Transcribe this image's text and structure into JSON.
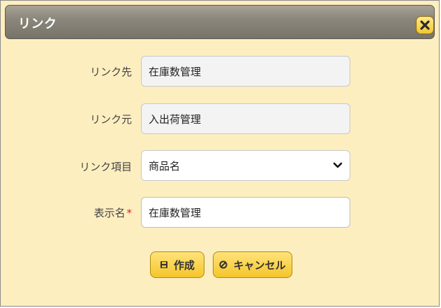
{
  "dialog": {
    "title": "リンク",
    "close_icon": "close-icon"
  },
  "form": {
    "link_target": {
      "label": "リンク先",
      "value": "在庫数管理"
    },
    "link_source": {
      "label": "リンク元",
      "value": "入出荷管理"
    },
    "link_item": {
      "label": "リンク項目",
      "value": "商品名",
      "icon": "chevron-down-icon"
    },
    "display_name": {
      "label": "表示名",
      "required_mark": "*",
      "value": "在庫数管理"
    }
  },
  "buttons": {
    "create": {
      "label": "作成",
      "icon": "save-icon"
    },
    "cancel": {
      "label": "キャンセル",
      "icon": "cancel-icon"
    }
  },
  "colors": {
    "background": "#fdeec0",
    "titlebar": "#8b877c",
    "button": "#f5c62a",
    "required": "#dd2222"
  }
}
